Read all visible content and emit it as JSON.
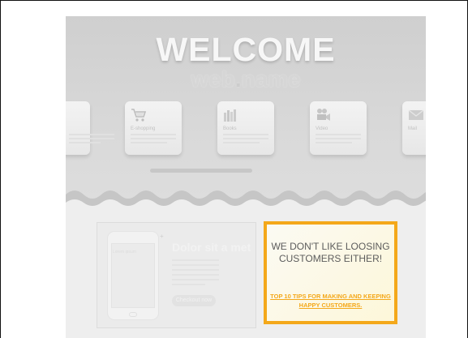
{
  "hero": {
    "title": "WELCOME",
    "logo_main": "web",
    "logo_dot": ".",
    "logo_tail": "name"
  },
  "services": [
    {
      "label": "",
      "icon": "doc-icon"
    },
    {
      "label": "E-shopping",
      "icon": "cart-icon"
    },
    {
      "label": "Books",
      "icon": "books-icon"
    },
    {
      "label": "Video",
      "icon": "video-camera-icon"
    },
    {
      "label": "Mail",
      "icon": "mail-icon"
    }
  ],
  "promo": {
    "phone_title": "Lorem ipsum",
    "headline": "Dolor sit a met",
    "button_label": "Checkout now"
  },
  "highlight": {
    "message": "WE DON'T LIKE LOOSING CUSTOMERS EITHER!",
    "link_text": "TOP 10 TIPS FOR MAKING AND KEEPING HAPPY CUSTOMERS."
  },
  "colors": {
    "accent": "#f4a81a",
    "hero_bg": "#d4d4d4",
    "text_dark": "#5c5c5c"
  }
}
